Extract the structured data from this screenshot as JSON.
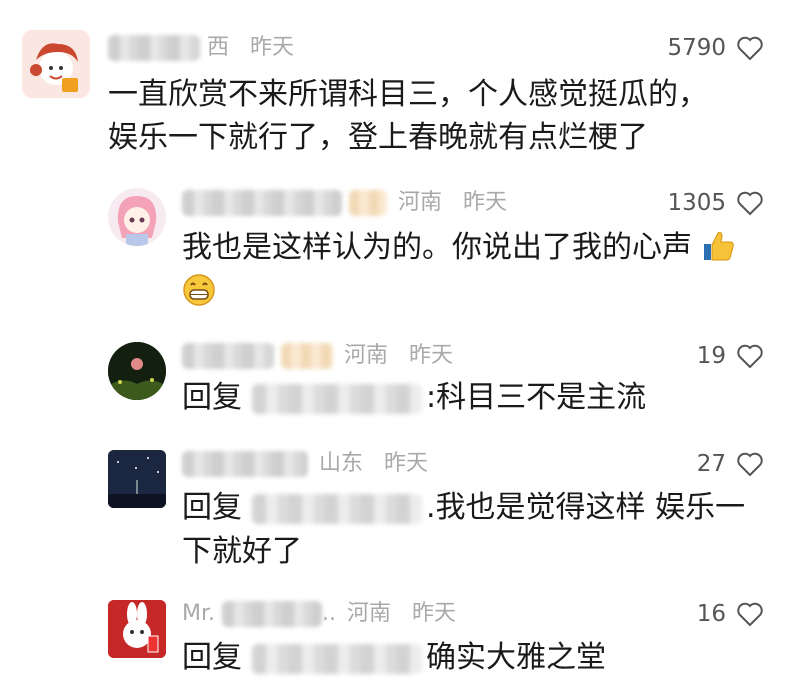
{
  "comments": [
    {
      "location": "西",
      "time": "昨天",
      "likes": "5790",
      "lines": [
        "一直欣赏不来所谓科目三，个人感觉挺瓜的，",
        "娱乐一下就行了，登上春晚就有点烂梗了"
      ]
    },
    {
      "location": "河南",
      "time": "昨天",
      "likes": "1305",
      "line1": "我也是这样认为的。你说出了我的心声",
      "emojis": [
        "thumbs-up-icon",
        "grin-icon"
      ]
    },
    {
      "location": "河南",
      "time": "昨天",
      "likes": "19",
      "reply_prefix": "回复",
      "reply_text": ":科目三不是主流"
    },
    {
      "location": "山东",
      "time": "昨天",
      "likes": "27",
      "reply_prefix": "回复",
      "reply_text": ".我也是觉得这样   娱乐一",
      "reply_text2": "下就好了"
    },
    {
      "name_visible": "Mr. ",
      "name_suffix": "..",
      "location": "河南",
      "time": "昨天",
      "likes": "16",
      "reply_prefix": "回复",
      "reply_text": "确实大雅之堂"
    }
  ],
  "colors": {
    "meta": "#a9a9a9",
    "text": "#1a1a1a",
    "likes": "#555555"
  }
}
